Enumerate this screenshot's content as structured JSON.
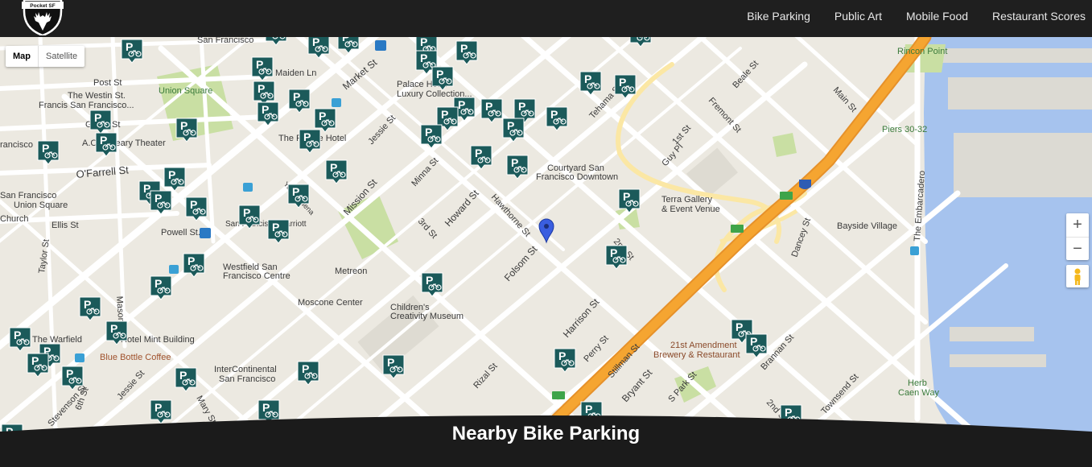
{
  "nav": {
    "logo_text": "Pocket SF",
    "items": [
      "Bike Parking",
      "Public Art",
      "Mobile Food",
      "Restaurant Scores"
    ]
  },
  "map_controls": {
    "map_label": "Map",
    "satellite_label": "Satellite",
    "zoom_in": "+",
    "zoom_out": "−"
  },
  "footer": {
    "title": "Nearby Bike Parking"
  },
  "marker_glyph": "P",
  "colors": {
    "marker": "#1b5a5a",
    "freeway": "#f5a531",
    "water": "#a6c3ee",
    "park": "#c9dfa3",
    "topbar": "#1f1f1f"
  },
  "map": {
    "labels": [
      "San Francisco",
      "Maiden Ln",
      "Post St",
      "Union Square",
      "The Westin St.",
      "Francis San Francisco...",
      "Geary St",
      "A.C.T. Geary Theater",
      "rancisco",
      "O'Farrell St",
      "Ellis St",
      "Palace Hotel",
      "Luxury Collection...",
      "The Palace Hotel",
      "Market St",
      "Jessie St",
      "Mission St",
      "Minna St",
      "3rd St",
      "Howard St",
      "Hawthorne St",
      "Folsom St",
      "Courtyard San",
      "Francisco Downtown",
      "Terra Gallery",
      "& Event Venue",
      "Guy Pl",
      "1st St",
      "Beale St",
      "Fremont St",
      "Main St",
      "Rincon Point",
      "Piers 30-32",
      "The Embarcadero",
      "Bayside Village",
      "Dancey St",
      "Harrison St",
      "2nd St",
      "Perry St",
      "Stillman St",
      "21st Amendment",
      "Brewery & Restaurant",
      "Brannan St",
      "Bryant St",
      "S Park St",
      "Herb",
      "Caen Way",
      "Rizal St",
      "Metreon",
      "Moscone Center",
      "Children's",
      "Creativity Museum",
      "Westfield San",
      "Francisco Centre",
      "Powell St.",
      "Mason St",
      "Taylor St",
      "The Warfield",
      "Hotel Mint Building",
      "Blue Bottle Coffee",
      "InterContinental",
      "San Francisco",
      "Jessie St",
      "Mary St",
      "6th St",
      "Stevenson St",
      "Union Square",
      "San Francisco",
      "Church",
      "Tehama St",
      "Yerba Buena",
      "2nd St",
      "Townsend St",
      "San Francisco Marriott"
    ]
  }
}
